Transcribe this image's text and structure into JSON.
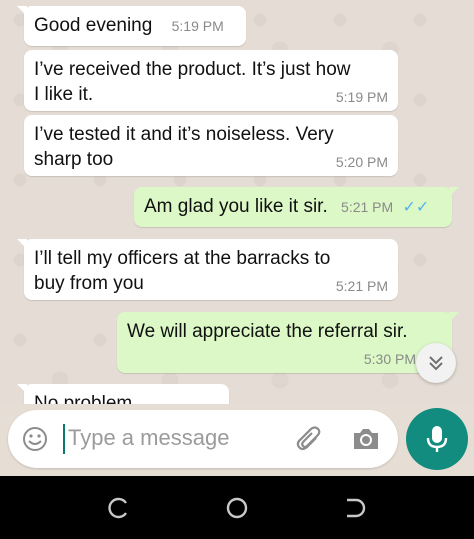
{
  "messages": [
    {
      "dir": "in",
      "text": "Good evening",
      "time": "5:19 PM"
    },
    {
      "dir": "in",
      "text_line1": "I’ve received the product. It’s just how",
      "text_line2": "I like it.",
      "time": "5:19 PM"
    },
    {
      "dir": "in",
      "text_line1": "I’ve tested it and it’s noiseless. Very",
      "text_line2": "sharp too",
      "time": "5:20 PM"
    },
    {
      "dir": "out",
      "text": "Am glad you like it sir.",
      "time": "5:21 PM"
    },
    {
      "dir": "in",
      "text_line1": "I’ll tell my officers at the barracks to",
      "text_line2": "buy from you",
      "time": "5:21 PM"
    },
    {
      "dir": "out",
      "text": "We will appreciate the referral sir.",
      "time": "5:30 PM"
    },
    {
      "dir": "in",
      "text": "No problem",
      "time": ""
    }
  ],
  "input": {
    "placeholder": "Type a message"
  },
  "icons": {
    "emoji": "emoji-icon",
    "attach": "paperclip-icon",
    "camera": "camera-icon",
    "mic": "microphone-icon",
    "scroll": "double-chevron-down-icon",
    "read_receipt": "double-check-icon"
  },
  "colors": {
    "incoming": "#ffffff",
    "outgoing": "#dcf8c6",
    "accent": "#128c7e",
    "tick": "#4fb6ec"
  }
}
